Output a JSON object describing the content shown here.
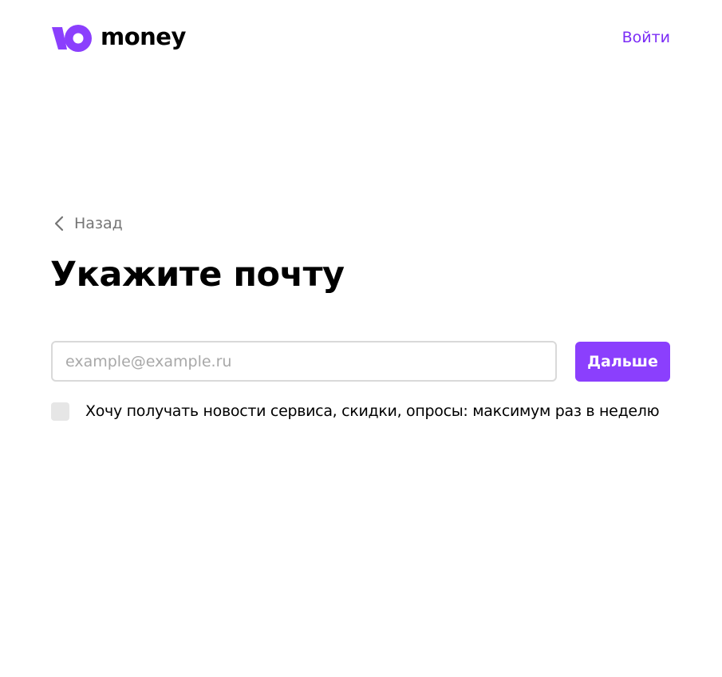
{
  "header": {
    "logo_text": "money",
    "login_label": "Войти"
  },
  "back": {
    "label": "Назад"
  },
  "form": {
    "title": "Укажите почту",
    "email_placeholder": "example@example.ru",
    "email_value": "",
    "next_label": "Дальше",
    "subscribe_label": "Хочу получать новости сервиса, скидки, опросы: максимум раз в неделю",
    "subscribe_checked": false
  },
  "colors": {
    "brand": "#8b3ffd",
    "link": "#7b2cf6",
    "muted_text": "#757575",
    "input_border": "#d9d9d9",
    "checkbox_bg": "#e6e6e6"
  },
  "icons": {
    "logo": "yoomoney-logo-icon",
    "back": "chevron-left-icon"
  }
}
